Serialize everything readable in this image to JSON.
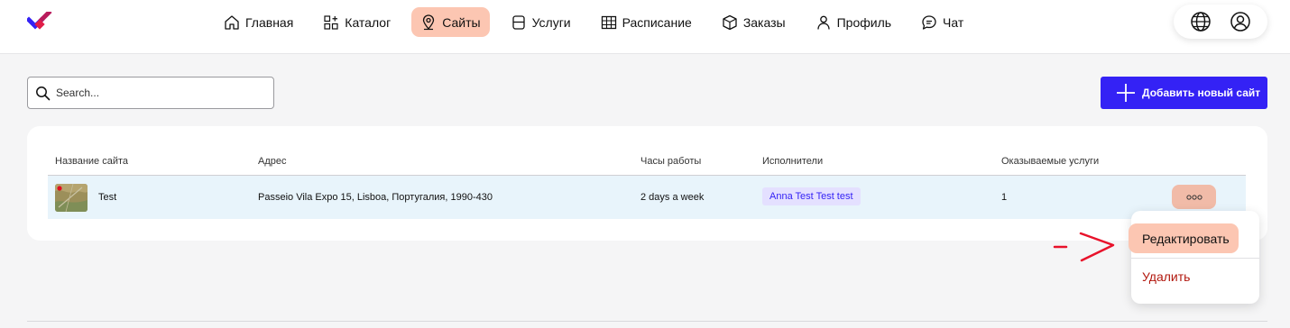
{
  "nav": {
    "items": [
      {
        "label": "Главная",
        "icon": "home-icon"
      },
      {
        "label": "Каталог",
        "icon": "catalog-icon"
      },
      {
        "label": "Сайты",
        "icon": "location-pin-icon",
        "active": true
      },
      {
        "label": "Услуги",
        "icon": "services-icon"
      },
      {
        "label": "Расписание",
        "icon": "schedule-grid-icon"
      },
      {
        "label": "Заказы",
        "icon": "box-icon"
      },
      {
        "label": "Профиль",
        "icon": "user-icon"
      },
      {
        "label": "Чат",
        "icon": "chat-bubble-icon"
      }
    ],
    "actions": [
      {
        "icon": "globe-icon"
      },
      {
        "icon": "account-icon"
      }
    ]
  },
  "search": {
    "placeholder": "Search..."
  },
  "add_button": {
    "label": "Добавить новый сайт",
    "icon": "plus-icon"
  },
  "table": {
    "headers": [
      "Название сайта",
      "Адрес",
      "Часы работы",
      "Исполнители",
      "Оказываемые услуги"
    ],
    "rows": [
      {
        "name": "Test",
        "address": "Passeio Vila Expo 15, Lisboa, Португалия, 1990-430",
        "hours": "2 days a week",
        "performers": [
          "Anna Test Test test"
        ],
        "services": "1"
      }
    ]
  },
  "row_menu": {
    "edit": "Редактировать",
    "delete": "Удалить"
  },
  "colors": {
    "accent": "#3422f5",
    "active_nav": "#fcc6b2",
    "row_highlight": "#e8f4fb",
    "chip_bg": "#e4e0ff",
    "danger": "#b2180e",
    "annotation_arrow": "#e8122b"
  }
}
